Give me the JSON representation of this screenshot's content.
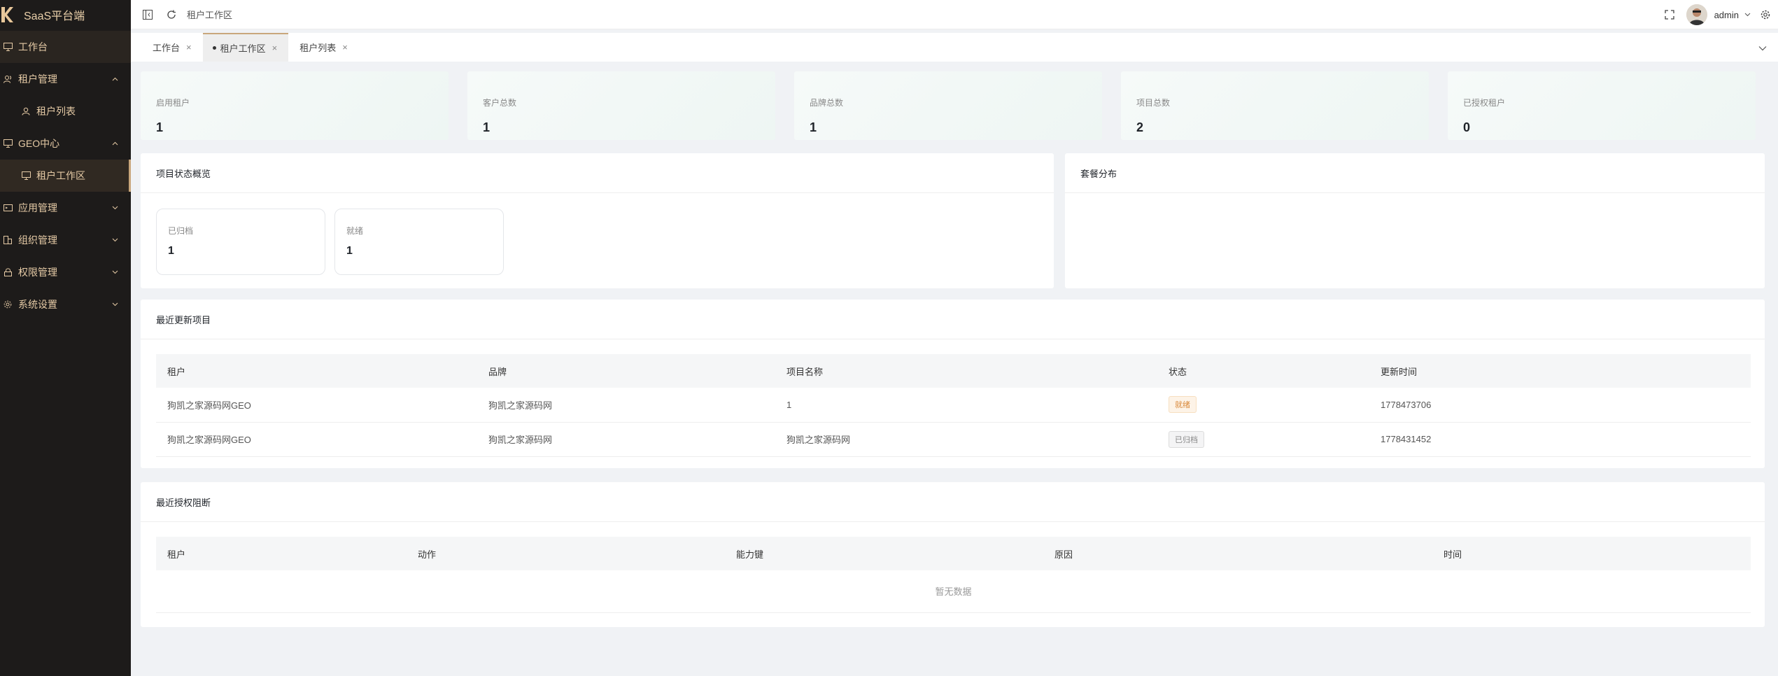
{
  "app": {
    "title": "SaaS平台端"
  },
  "sidebar": {
    "items": [
      {
        "label": "工作台"
      },
      {
        "label": "租户管理"
      },
      {
        "label": "租户列表"
      },
      {
        "label": "GEO中心"
      },
      {
        "label": "租户工作区"
      },
      {
        "label": "应用管理"
      },
      {
        "label": "组织管理"
      },
      {
        "label": "权限管理"
      },
      {
        "label": "系统设置"
      }
    ]
  },
  "topbar": {
    "breadcrumb": "租户工作区",
    "username": "admin"
  },
  "tabs": [
    {
      "label": "工作台"
    },
    {
      "label": "租户工作区"
    },
    {
      "label": "租户列表"
    }
  ],
  "stats": [
    {
      "label": "启用租户",
      "value": "1"
    },
    {
      "label": "客户总数",
      "value": "1"
    },
    {
      "label": "品牌总数",
      "value": "1"
    },
    {
      "label": "项目总数",
      "value": "2"
    },
    {
      "label": "已授权租户",
      "value": "0"
    }
  ],
  "project_status": {
    "title": "项目状态概览",
    "items": [
      {
        "label": "已归档",
        "value": "1"
      },
      {
        "label": "就绪",
        "value": "1"
      }
    ]
  },
  "package_dist": {
    "title": "套餐分布"
  },
  "recent_projects": {
    "title": "最近更新项目",
    "columns": [
      "租户",
      "品牌",
      "项目名称",
      "状态",
      "更新时间"
    ],
    "rows": [
      {
        "tenant": "狗凯之家源码网GEO",
        "brand": "狗凯之家源码网",
        "project": "1",
        "status": "就绪",
        "updated": "1778473706"
      },
      {
        "tenant": "狗凯之家源码网GEO",
        "brand": "狗凯之家源码网",
        "project": "狗凯之家源码网",
        "status": "已归档",
        "updated": "1778431452"
      }
    ],
    "status_colors": {
      "ready": "#d9893a",
      "archived": "#888888"
    }
  },
  "recent_auth_block": {
    "title": "最近授权阻断",
    "columns": [
      "租户",
      "动作",
      "能力键",
      "原因",
      "时间"
    ],
    "empty": "暂无数据"
  },
  "colors": {
    "accent": "#c9a77c",
    "sidebar_bg": "#1d1b1a",
    "sidebar_text": "#e6cba6"
  },
  "icons": [
    "logo-k-icon",
    "monitor-icon",
    "users-icon",
    "user-icon",
    "chevron-up-icon",
    "chevron-down-icon",
    "app-icon",
    "org-icon",
    "lock-icon",
    "gear-icon",
    "collapse-icon",
    "refresh-icon",
    "fullscreen-icon",
    "close-icon"
  ]
}
